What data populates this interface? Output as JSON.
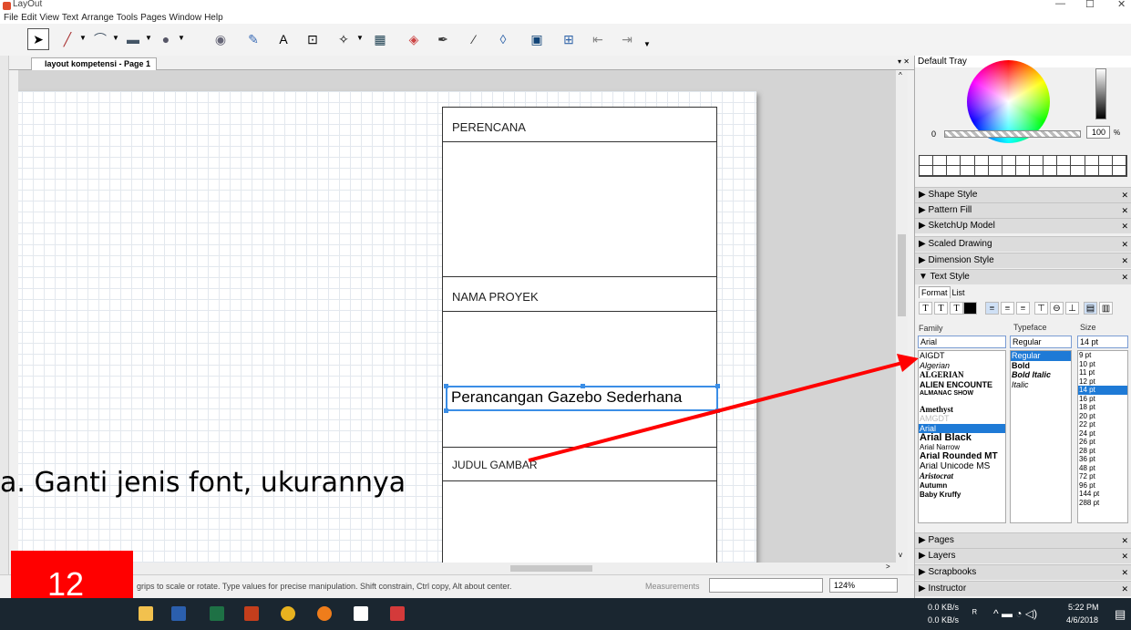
{
  "window": {
    "title": "LayOut"
  },
  "menu": [
    "File",
    "Edit",
    "View",
    "Text",
    "Arrange",
    "Tools",
    "Pages",
    "Window",
    "Help"
  ],
  "document_tab": "layout kompetensi - Page 1",
  "title_block": {
    "perencana_label": "PERENCANA",
    "nama_proyek_label": "NAMA PROYEK",
    "judul_gambar_label": "JUDUL GAMBAR",
    "selected_text": "Perancangan Gazebo Sederhana"
  },
  "status": {
    "hint": "grips to scale or rotate. Type values for precise manipulation. Shift constrain, Ctrl copy, Alt about center.",
    "measurements_label": "Measurements",
    "zoom": "124%"
  },
  "tray": {
    "title": "Default Tray",
    "color_value_label": "0",
    "opacity_value": "100",
    "opacity_unit": "%",
    "panels": [
      "Shape Style",
      "Pattern Fill",
      "SketchUp Model",
      "Scaled Drawing",
      "Dimension Style",
      "Text Style"
    ],
    "bottom_panels": [
      "Pages",
      "Layers",
      "Scrapbooks",
      "Instructor"
    ],
    "text_style": {
      "tabs": [
        "Format",
        "List"
      ],
      "family_header": "Family",
      "typeface_header": "Typeface",
      "size_header": "Size",
      "family_value": "Arial",
      "typeface_value": "Regular",
      "size_value": "14 pt",
      "families": [
        "AIGDT",
        "Algerian",
        "ALGERIAN",
        "ALIEN ENCOUNTE",
        "ALMANAC SHOW",
        "Amethyst",
        "AMGDT",
        "Arial",
        "Arial Black",
        "Arial Narrow",
        "Arial Rounded MT",
        "Arial Unicode MS",
        "Aristocrat",
        "Autumn",
        "Baby Kruffy"
      ],
      "selected_family": "Arial",
      "typefaces": [
        "Regular",
        "Bold",
        "Bold Italic",
        "Italic"
      ],
      "selected_typeface": "Regular",
      "sizes": [
        "9 pt",
        "10 pt",
        "11 pt",
        "12 pt",
        "14 pt",
        "16 pt",
        "18 pt",
        "20 pt",
        "22 pt",
        "24 pt",
        "26 pt",
        "28 pt",
        "36 pt",
        "48 pt",
        "72 pt",
        "96 pt",
        "144 pt",
        "288 pt"
      ],
      "selected_size": "14 pt"
    }
  },
  "annotation": {
    "instruction": "a.   Ganti jenis font, ukurannya",
    "page_number": "12",
    "arrow_color": "#ff0000"
  },
  "taskbar": {
    "net_down": "0.0 KB/s",
    "net_up": "0.0 KB/s",
    "time": "5:22 PM",
    "date": "4/6/2018"
  }
}
